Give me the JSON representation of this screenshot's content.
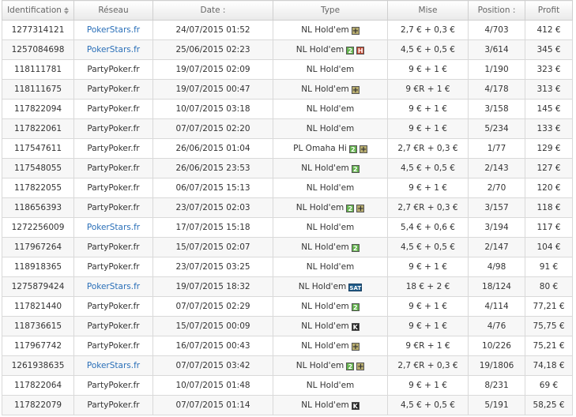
{
  "headers": [
    "Identification",
    "Réseau",
    "Date :",
    "Type",
    "Mise",
    "Position :",
    "Profit"
  ],
  "colors": {
    "link": "#2a6fb8",
    "badge_plus": "#b8ad6f",
    "badge_double": "#63b34d",
    "badge_head": "#c0452f",
    "badge_ko": "#222222",
    "badge_sat": "#1f5c8a"
  },
  "badge_labels": {
    "plus": "+",
    "double": "2",
    "head": "H",
    "ko": "K",
    "sat": "SAT"
  },
  "rows": [
    {
      "id": "1277314121",
      "network": "PokerStars.fr",
      "date": "24/07/2015 01:52",
      "type": "NL Hold'em",
      "badges": [
        "plus"
      ],
      "stake": "2,7 € + 0,3 €",
      "position": "4/703",
      "profit": "412 €"
    },
    {
      "id": "1257084698",
      "network": "PokerStars.fr",
      "date": "25/06/2015 02:23",
      "type": "NL Hold'em",
      "badges": [
        "double",
        "head"
      ],
      "stake": "4,5 € + 0,5 €",
      "position": "3/614",
      "profit": "345 €"
    },
    {
      "id": "118111781",
      "network": "PartyPoker.fr",
      "date": "19/07/2015 02:09",
      "type": "NL Hold'em",
      "badges": [],
      "stake": "9 € + 1 €",
      "position": "1/190",
      "profit": "323 €"
    },
    {
      "id": "118111675",
      "network": "PartyPoker.fr",
      "date": "19/07/2015 00:47",
      "type": "NL Hold'em",
      "badges": [
        "plus"
      ],
      "stake": "9 €R + 1 €",
      "position": "4/178",
      "profit": "313 €"
    },
    {
      "id": "117822094",
      "network": "PartyPoker.fr",
      "date": "10/07/2015 03:18",
      "type": "NL Hold'em",
      "badges": [],
      "stake": "9 € + 1 €",
      "position": "3/158",
      "profit": "145 €"
    },
    {
      "id": "117822061",
      "network": "PartyPoker.fr",
      "date": "07/07/2015 02:20",
      "type": "NL Hold'em",
      "badges": [],
      "stake": "9 € + 1 €",
      "position": "5/234",
      "profit": "133 €"
    },
    {
      "id": "117547611",
      "network": "PartyPoker.fr",
      "date": "26/06/2015 01:04",
      "type": "PL Omaha Hi",
      "badges": [
        "double",
        "plus"
      ],
      "stake": "2,7 €R + 0,3 €",
      "position": "1/77",
      "profit": "129 €"
    },
    {
      "id": "117548055",
      "network": "PartyPoker.fr",
      "date": "26/06/2015 23:53",
      "type": "NL Hold'em",
      "badges": [
        "double"
      ],
      "stake": "4,5 € + 0,5 €",
      "position": "2/143",
      "profit": "127 €"
    },
    {
      "id": "117822055",
      "network": "PartyPoker.fr",
      "date": "06/07/2015 15:13",
      "type": "NL Hold'em",
      "badges": [],
      "stake": "9 € + 1 €",
      "position": "2/70",
      "profit": "120 €"
    },
    {
      "id": "118656393",
      "network": "PartyPoker.fr",
      "date": "23/07/2015 02:03",
      "type": "NL Hold'em",
      "badges": [
        "double",
        "plus"
      ],
      "stake": "2,7 €R + 0,3 €",
      "position": "3/157",
      "profit": "118 €"
    },
    {
      "id": "1272256009",
      "network": "PokerStars.fr",
      "date": "17/07/2015 15:18",
      "type": "NL Hold'em",
      "badges": [],
      "stake": "5,4 € + 0,6 €",
      "position": "3/194",
      "profit": "117 €"
    },
    {
      "id": "117967264",
      "network": "PartyPoker.fr",
      "date": "15/07/2015 02:07",
      "type": "NL Hold'em",
      "badges": [
        "double"
      ],
      "stake": "4,5 € + 0,5 €",
      "position": "2/147",
      "profit": "104 €"
    },
    {
      "id": "118918365",
      "network": "PartyPoker.fr",
      "date": "23/07/2015 03:25",
      "type": "NL Hold'em",
      "badges": [],
      "stake": "9 € + 1 €",
      "position": "4/98",
      "profit": "91 €"
    },
    {
      "id": "1275879424",
      "network": "PokerStars.fr",
      "date": "19/07/2015 18:32",
      "type": "NL Hold'em",
      "badges": [
        "sat"
      ],
      "stake": "18 € + 2 €",
      "position": "18/124",
      "profit": "80 €"
    },
    {
      "id": "117821440",
      "network": "PartyPoker.fr",
      "date": "07/07/2015 02:29",
      "type": "NL Hold'em",
      "badges": [
        "double"
      ],
      "stake": "9 € + 1 €",
      "position": "4/114",
      "profit": "77,21 €"
    },
    {
      "id": "118736615",
      "network": "PartyPoker.fr",
      "date": "15/07/2015 00:09",
      "type": "NL Hold'em",
      "badges": [
        "ko"
      ],
      "stake": "9 € + 1 €",
      "position": "4/76",
      "profit": "75,75 €"
    },
    {
      "id": "117967742",
      "network": "PartyPoker.fr",
      "date": "16/07/2015 00:43",
      "type": "NL Hold'em",
      "badges": [
        "plus"
      ],
      "stake": "9 €R + 1 €",
      "position": "10/226",
      "profit": "75,21 €"
    },
    {
      "id": "1261938635",
      "network": "PokerStars.fr",
      "date": "07/07/2015 03:42",
      "type": "NL Hold'em",
      "badges": [
        "double",
        "plus"
      ],
      "stake": "2,7 €R + 0,3 €",
      "position": "19/1806",
      "profit": "74,18 €"
    },
    {
      "id": "117822064",
      "network": "PartyPoker.fr",
      "date": "10/07/2015 01:48",
      "type": "NL Hold'em",
      "badges": [],
      "stake": "9 € + 1 €",
      "position": "8/231",
      "profit": "69 €"
    },
    {
      "id": "117822079",
      "network": "PartyPoker.fr",
      "date": "07/07/2015 01:14",
      "type": "NL Hold'em",
      "badges": [
        "ko"
      ],
      "stake": "4,5 € + 0,5 €",
      "position": "5/191",
      "profit": "58,25 €"
    }
  ]
}
